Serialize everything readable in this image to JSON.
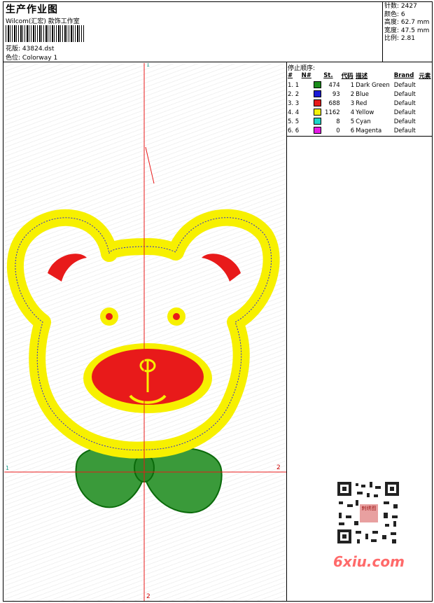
{
  "header": {
    "title": "生产作业图",
    "subtitle": "Wilcom(汇宏) 款饰工作室",
    "design_label": "花版:",
    "design_value": "43824.dst",
    "colorway_label": "色位:",
    "colorway_value": "Colorway 1"
  },
  "stats": [
    {
      "label": "针数:",
      "value": "2427"
    },
    {
      "label": "颜色:",
      "value": "6"
    },
    {
      "label": "高度:",
      "value": "62.7 mm"
    },
    {
      "label": "宽度:",
      "value": "47.5 mm"
    },
    {
      "label": "比例:",
      "value": "2.81"
    }
  ],
  "stop_sequence": {
    "title": "停止顺序:",
    "headers": [
      "#",
      "N#",
      "St.",
      "代码",
      "描述",
      "Brand",
      "元素"
    ],
    "rows": [
      {
        "idx": "1. 1",
        "color": "#1a8c1a",
        "st": "474",
        "code": "1",
        "desc": "Dark Green",
        "brand": "Default"
      },
      {
        "idx": "2. 2",
        "color": "#1a1ad6",
        "st": "93",
        "code": "2",
        "desc": "Blue",
        "brand": "Default"
      },
      {
        "idx": "3. 3",
        "color": "#e81a1a",
        "st": "688",
        "code": "3",
        "desc": "Red",
        "brand": "Default"
      },
      {
        "idx": "4. 4",
        "color": "#f2f20a",
        "st": "1162",
        "code": "4",
        "desc": "Yellow",
        "brand": "Default"
      },
      {
        "idx": "5. 5",
        "color": "#1ad6c8",
        "st": "8",
        "code": "5",
        "desc": "Cyan",
        "brand": "Default"
      },
      {
        "idx": "6. 6",
        "color": "#e61ae6",
        "st": "0",
        "code": "6",
        "desc": "Magenta",
        "brand": "Default"
      }
    ]
  },
  "axes": {
    "top": "1",
    "left": "1",
    "right": "2",
    "bottom": "2"
  },
  "watermark": "6xiu.com",
  "qr_center_text": "刺绣图"
}
